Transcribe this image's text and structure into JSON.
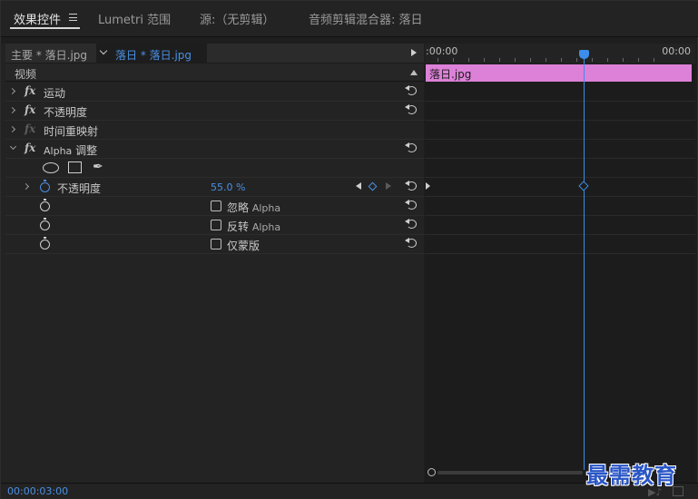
{
  "tabs": [
    {
      "label": "效果控件"
    },
    {
      "label": "Lumetri 范围"
    },
    {
      "label": "源:（无剪辑）"
    },
    {
      "label": "音频剪辑混合器: 落日"
    }
  ],
  "source": {
    "master_label": "主要 * 落日.jpg",
    "sequence_label": "落日 * 落日.jpg"
  },
  "section": {
    "video_label": "视频"
  },
  "effects": [
    {
      "name": "运动"
    },
    {
      "name": "不透明度"
    },
    {
      "name": "时间重映射"
    },
    {
      "name_prefix": "Alpha",
      "name_suffix": "调整"
    }
  ],
  "alpha_params": {
    "opacity_label": "不透明度",
    "opacity_value": "55.0 %",
    "ignore_alpha": {
      "label": "忽略",
      "suffix": "Alpha",
      "checked": false
    },
    "invert_alpha": {
      "label": "反转",
      "suffix": "Alpha",
      "checked": false
    },
    "mask_only": {
      "label": "仅蒙版",
      "checked": false
    }
  },
  "timeline": {
    "start_time": ":00:00",
    "end_time": "00:00",
    "clip_label": "落日.jpg",
    "clip_color": "#dd81d8",
    "playhead_color": "#3b8eea"
  },
  "footer": {
    "timecode": "00:00:03:00"
  },
  "watermark": "最需教育"
}
